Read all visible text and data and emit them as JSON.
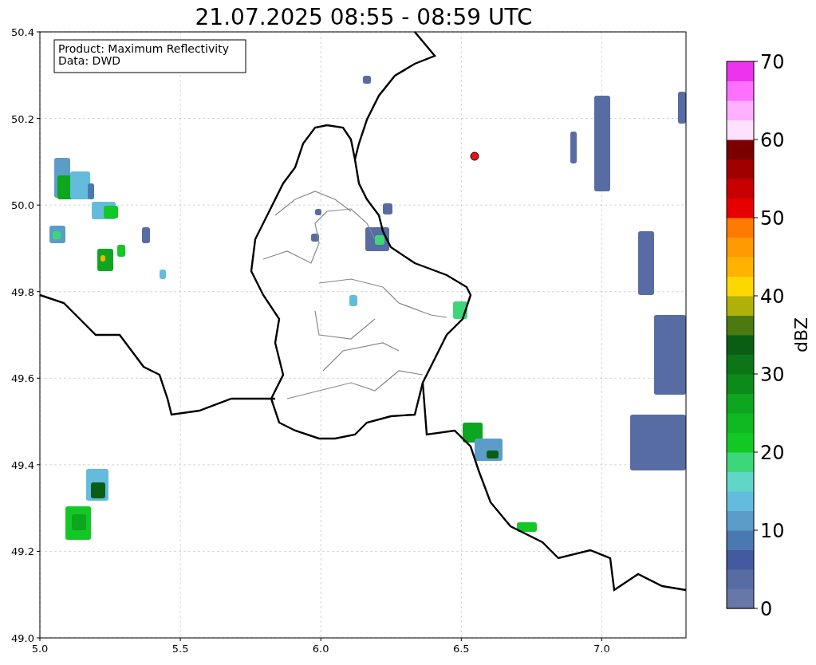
{
  "title": "21.07.2025 08:55 - 08:59 UTC",
  "info_box": [
    "Product: Maximum Reflectivity",
    "Data: DWD"
  ],
  "x_ticks": [
    "5.0",
    "5.5",
    "6.0",
    "6.5",
    "7.0"
  ],
  "y_ticks": [
    "50.4",
    "50.2",
    "50.0",
    "49.8",
    "49.6",
    "49.4",
    "49.2",
    "49.0"
  ],
  "colorbar": {
    "label": "dBZ",
    "ticks": [
      "70",
      "60",
      "50",
      "40",
      "30",
      "20",
      "10",
      "0"
    ],
    "bins": [
      {
        "color": "#6677a8"
      },
      {
        "color": "#586ca4"
      },
      {
        "color": "#435aa0"
      },
      {
        "color": "#4a78b0"
      },
      {
        "color": "#5b9dc8"
      },
      {
        "color": "#64bcdc"
      },
      {
        "color": "#60d6c6"
      },
      {
        "color": "#3ed67a"
      },
      {
        "color": "#12c825"
      },
      {
        "color": "#10b822"
      },
      {
        "color": "#0ea51f"
      },
      {
        "color": "#0c8a1a"
      },
      {
        "color": "#0b7518"
      },
      {
        "color": "#0a5e14"
      },
      {
        "color": "#4a7a10"
      },
      {
        "color": "#b0b00a"
      },
      {
        "color": "#ffd700"
      },
      {
        "color": "#ffb300"
      },
      {
        "color": "#ff9a00"
      },
      {
        "color": "#ff7a00"
      },
      {
        "color": "#e60000"
      },
      {
        "color": "#c80000"
      },
      {
        "color": "#a00000"
      },
      {
        "color": "#7a0000"
      },
      {
        "color": "#ffe0ff"
      },
      {
        "color": "#ffb0ff"
      },
      {
        "color": "#ff70ff"
      },
      {
        "color": "#ee33ee"
      }
    ]
  }
}
